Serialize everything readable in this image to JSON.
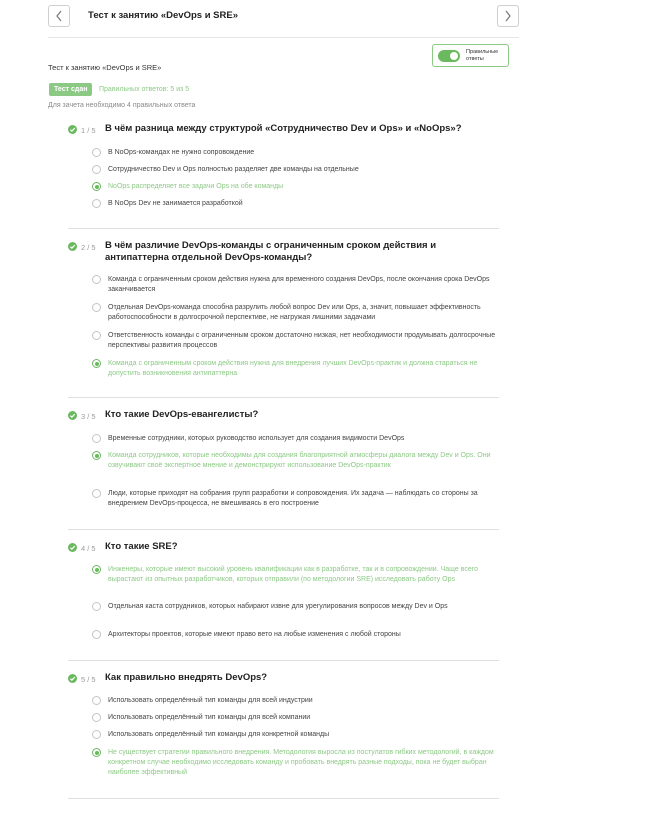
{
  "header": {
    "title": "Тест к занятию «DevOps и SRE»",
    "prev_icon": "chevron-left-icon",
    "next_icon": "chevron-right-icon"
  },
  "toggle": {
    "label": "Правильные ответы",
    "on": true,
    "color": "#6ab95f"
  },
  "breadcrumb": "Тест к занятию «DevOps и SRE»",
  "result": {
    "badge": "Тест сдан",
    "score": "Правильных ответов: 5 из 5",
    "requirement": "Для зачета необходимо 4 правильных ответа"
  },
  "colors": {
    "accent": "#8cc985",
    "accent_dark": "#6ab95f",
    "text": "#333333",
    "muted": "#9a9a9a"
  },
  "questions": [
    {
      "number": "1 / 5",
      "text": "В чём разница между структурой «Сотрудничество Dev и Ops» и «NoOps»?",
      "answers": [
        {
          "text": "В NoOps-командах не нужно сопровождение",
          "selected": false,
          "correct": false
        },
        {
          "text": "Сотрудничество Dev и Ops полностью разделяет две команды на отдельные",
          "selected": false,
          "correct": false
        },
        {
          "text": "NoOps распределяет все задачи Ops на обе команды",
          "selected": true,
          "correct": true
        },
        {
          "text": "В NoOps Dev не занимается разработкой",
          "selected": false,
          "correct": false
        }
      ]
    },
    {
      "number": "2 / 5",
      "text": "В чём различие DevOps-команды с ограниченным сроком действия и антипаттерна отдельной DevOps-команды?",
      "answers": [
        {
          "text": "Команда с ограниченным сроком действия нужна для временного создания DevOps, после окончания срока DevOps заканчивается",
          "selected": false,
          "correct": false
        },
        {
          "text": "Отдельная DevOps-команда способна разрулить любой вопрос Dev или Ops, а, значит, повышает эффективность работоспособности в долгосрочной перспективе, не нагружая лишними задачами",
          "selected": false,
          "correct": false
        },
        {
          "text": "Ответственность команды с ограниченным сроком достаточно низкая, нет необходимости продумывать долгосрочные перспективы развития процессов",
          "selected": false,
          "correct": false
        },
        {
          "text": "Команда с ограниченным сроком действия нужна для внедрения лучших DevOps-практик и должна стараться не допустить возникновения антипаттерна",
          "selected": true,
          "correct": true
        }
      ]
    },
    {
      "number": "3 / 5",
      "text": "Кто такие DevOps-евангелисты?",
      "answers": [
        {
          "text": "Временные сотрудники, которых руководство использует для создания видимости DevOps",
          "selected": false,
          "correct": false
        },
        {
          "text": "Команда сотрудников, которые необходимы для создания благоприятной атмосферы диалога между Dev и Ops. Они озвучивают своё экспертное мнение и демонстрируют использование DevOps-практик",
          "selected": true,
          "correct": true
        },
        {
          "text": "Люди, которые приходят на собрания групп разработки и сопровождения. Их задача — наблюдать со стороны за внедрением DevOps-процесса, не вмешиваясь в его построение",
          "selected": false,
          "correct": false
        }
      ]
    },
    {
      "number": "4 / 5",
      "text": "Кто такие SRE?",
      "answers": [
        {
          "text": "Инженеры, которые имеют высокий уровень квалификации как в разработке, так и в сопровождении. Чаще всего вырастают из опытных разработчиков, которых отправили (по методологии SRE) исследовать работу Ops",
          "selected": true,
          "correct": true
        },
        {
          "text": "Отдельная каста сотрудников, которых набирают извне для урегулирования вопросов между Dev и Ops",
          "selected": false,
          "correct": false
        },
        {
          "text": "Архитекторы проектов, которые имеют право вето на любые изменения с любой стороны",
          "selected": false,
          "correct": false
        }
      ]
    },
    {
      "number": "5 / 5",
      "text": "Как правильно внедрять DevOps?",
      "answers": [
        {
          "text": "Использовать определённый тип команды для всей индустрии",
          "selected": false,
          "correct": false
        },
        {
          "text": "Использовать определённый тип команды для всей компании",
          "selected": false,
          "correct": false
        },
        {
          "text": "Использовать определённый тип команды для конкретной команды",
          "selected": false,
          "correct": false
        },
        {
          "text": "Не существует стратегии правильного внедрения. Методология выросла из постулатов гибких методологий, в каждом конкретном случае необходимо исследовать команду и пробовать внедрять разные подходы, пока не будет выбран наиболее эффективный",
          "selected": true,
          "correct": true
        }
      ]
    }
  ]
}
